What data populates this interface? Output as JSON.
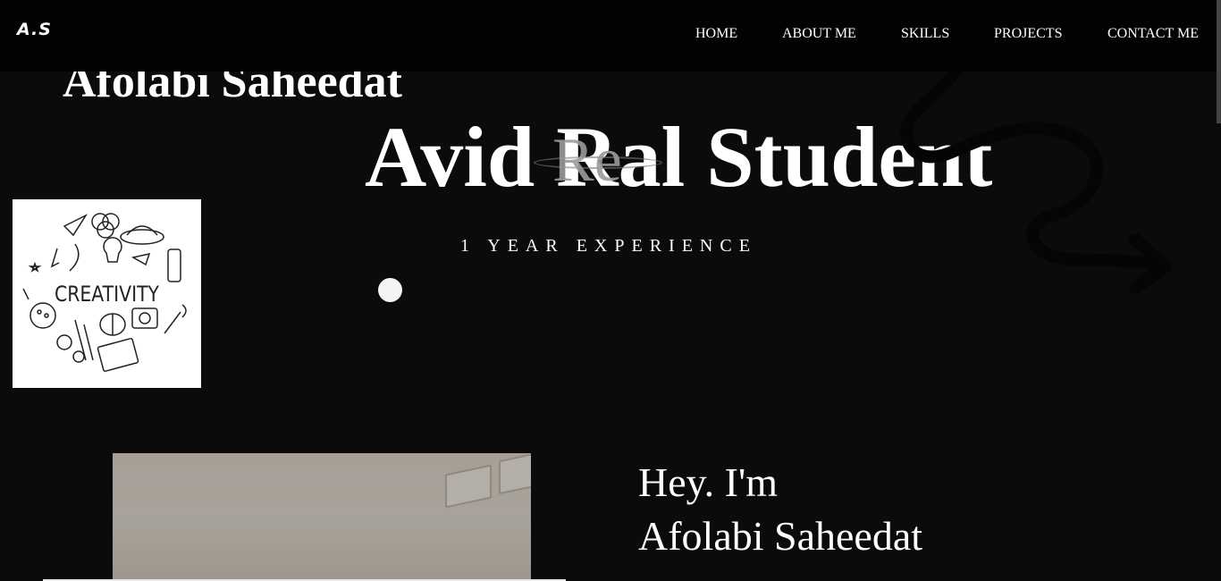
{
  "navbar": {
    "logo": "A.S",
    "links": [
      "HOME",
      "ABOUT ME",
      "SKILLS",
      "PROJECTS",
      "CONTACT ME"
    ]
  },
  "hero": {
    "name": "Afolabi Saheedat",
    "title_start": "Avid ",
    "title_mid": "Ral",
    "title_end": " Student",
    "ghost_text": "Re",
    "experience": "1 YEAR EXPERIENCE"
  },
  "creativity_image": {
    "label": "CREATIVITY"
  },
  "about": {
    "greeting_line1": "Hey. I'm",
    "greeting_line2": "Afolabi Saheedat"
  },
  "colors": {
    "background": "#0b0b0b",
    "navbar": "#020202",
    "text": "#ffffff"
  }
}
